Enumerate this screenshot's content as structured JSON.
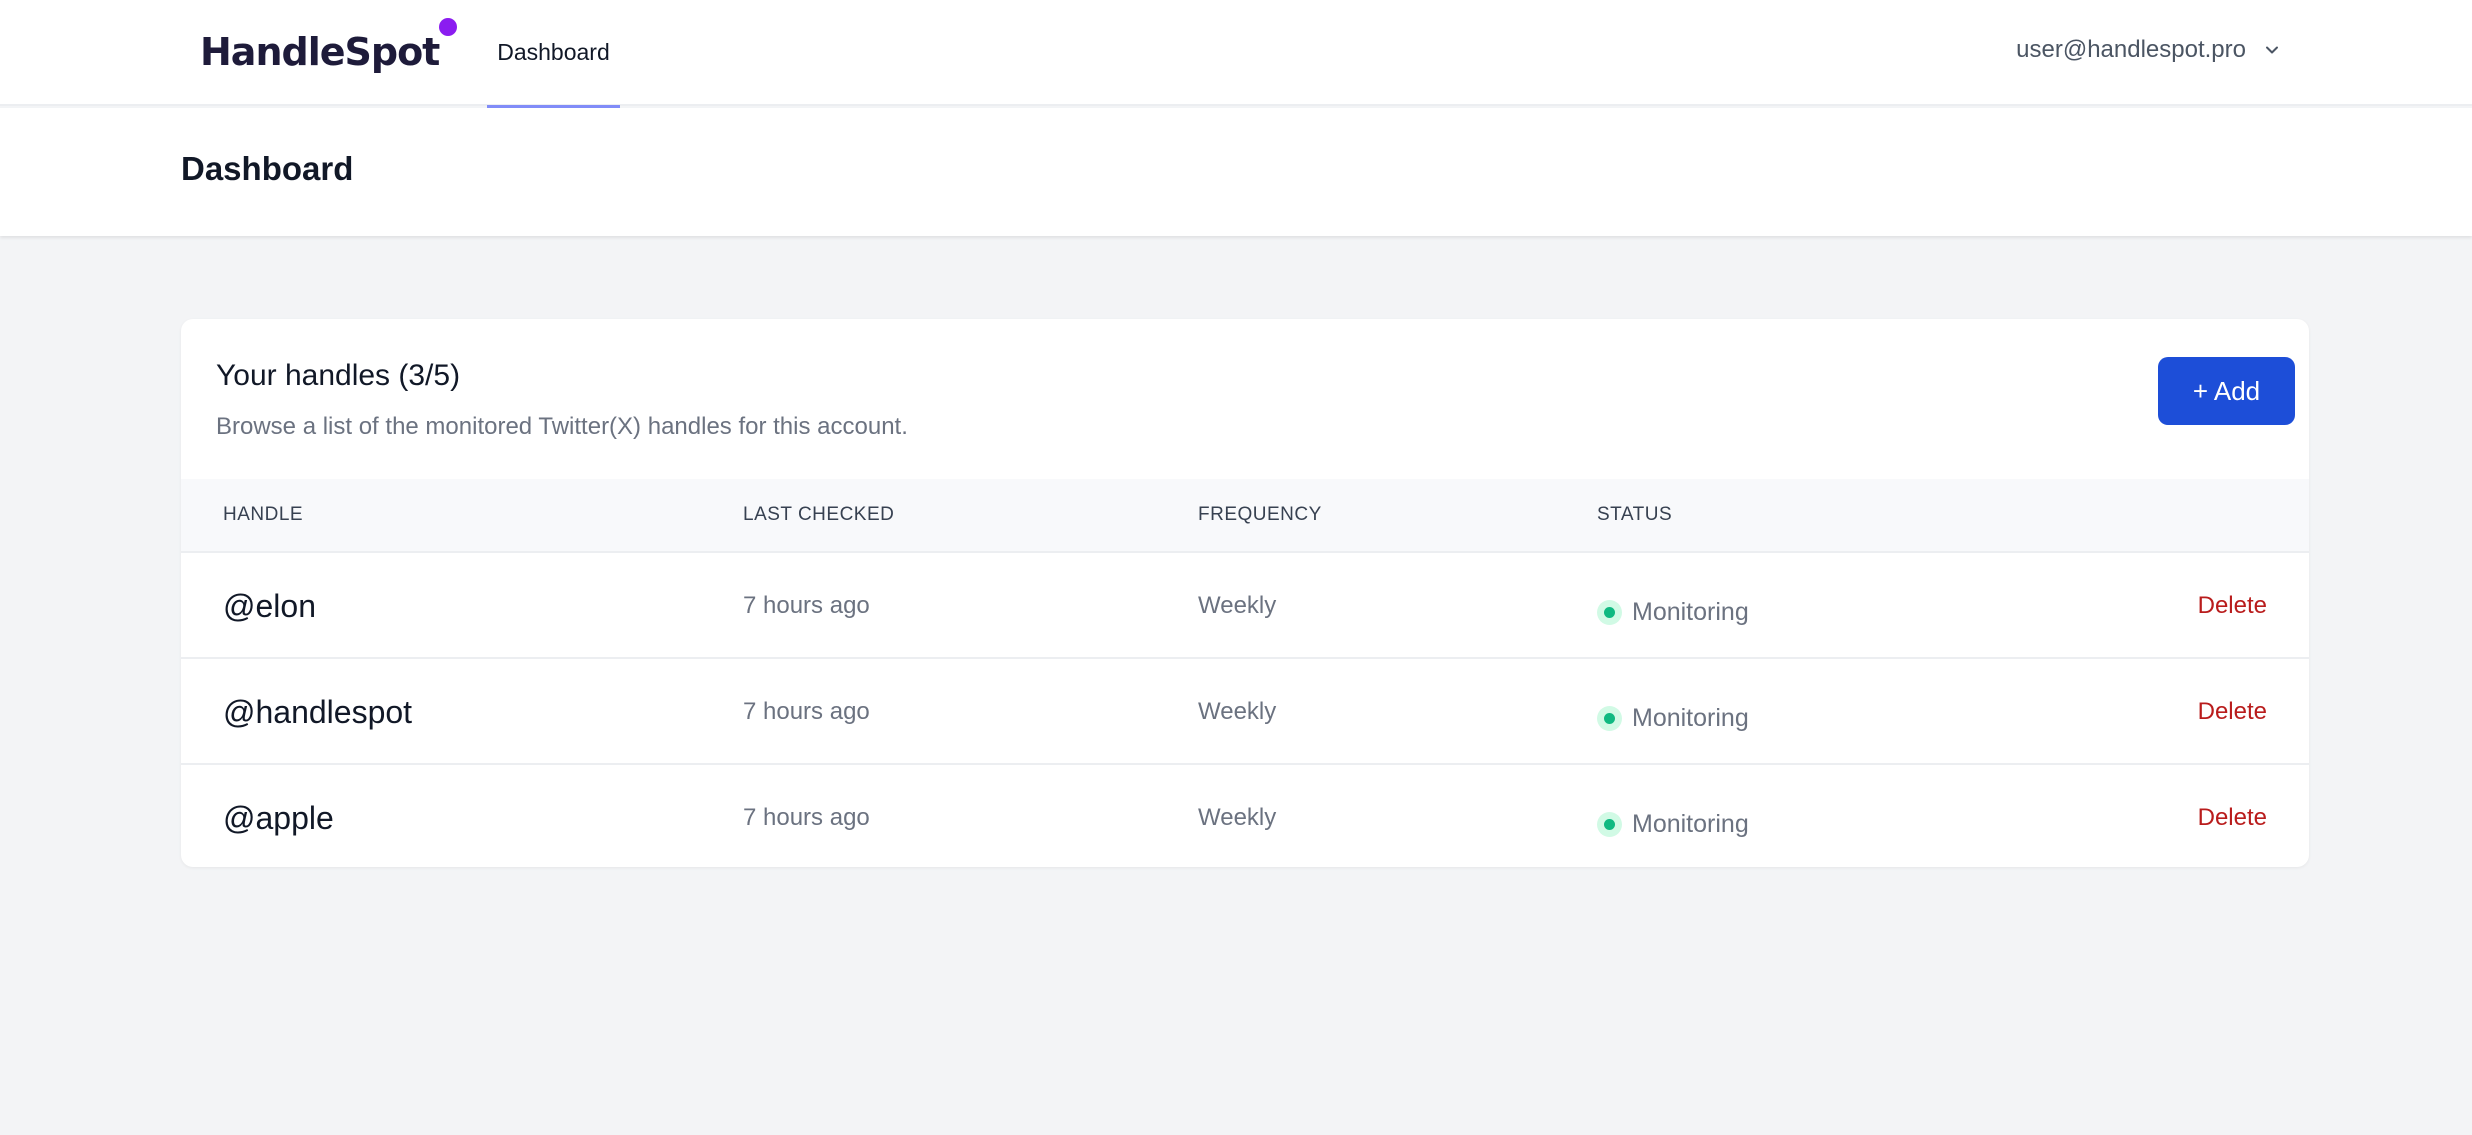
{
  "nav": {
    "logo": "HandleSpot",
    "tab": "Dashboard",
    "user_email": "user@handlespot.pro"
  },
  "header": {
    "title": "Dashboard"
  },
  "card": {
    "title": "Your handles (3/5)",
    "subtitle": "Browse a list of the monitored Twitter(X) handles for this account.",
    "add_label": "+ Add"
  },
  "table": {
    "columns": [
      "HANDLE",
      "LAST CHECKED",
      "FREQUENCY",
      "STATUS"
    ],
    "rows": [
      {
        "handle": "@elon",
        "last_checked": "7 hours ago",
        "frequency": "Weekly",
        "status": "Monitoring",
        "action": "Delete"
      },
      {
        "handle": "@handlespot",
        "last_checked": "7 hours ago",
        "frequency": "Weekly",
        "status": "Monitoring",
        "action": "Delete"
      },
      {
        "handle": "@apple",
        "last_checked": "7 hours ago",
        "frequency": "Weekly",
        "status": "Monitoring",
        "action": "Delete"
      }
    ]
  },
  "colors": {
    "accent": "#1d4ed8",
    "brand_dot": "#8b1cf0",
    "tab_underline": "#818cf8",
    "status_green": "#10b981",
    "delete_red": "#b91c1c"
  },
  "icons": {
    "user_menu": "chevron-down-icon",
    "status": "status-dot-icon"
  }
}
